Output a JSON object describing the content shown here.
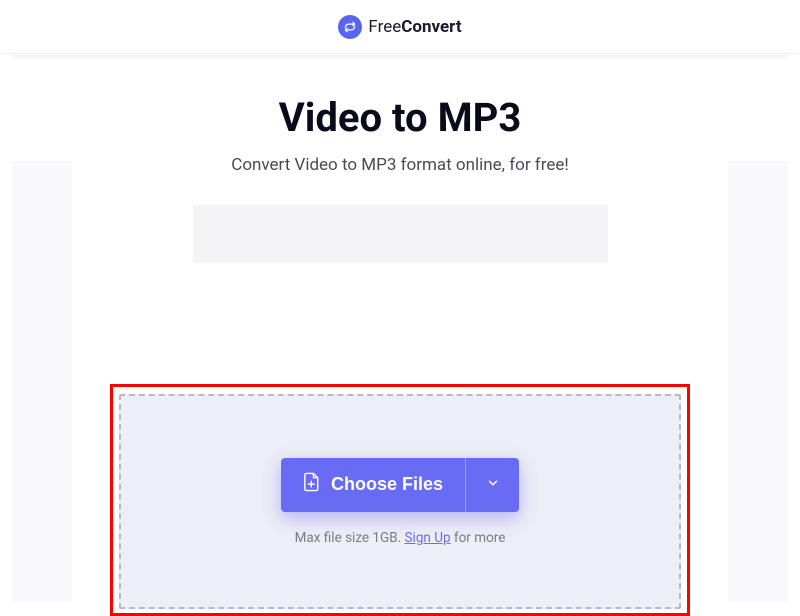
{
  "header": {
    "logo_light": "Free",
    "logo_bold": "Convert"
  },
  "page": {
    "title": "Video to MP3",
    "subtitle": "Convert Video to MP3 format online, for free!"
  },
  "dropzone": {
    "choose_files_label": "Choose Files",
    "note_prefix": "Max file size 1GB. ",
    "signup_label": "Sign Up",
    "note_suffix": " for more"
  },
  "colors": {
    "accent": "#686bf4",
    "highlight": "#ff0000"
  }
}
